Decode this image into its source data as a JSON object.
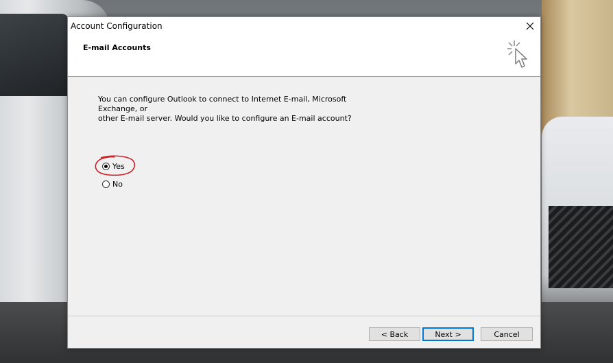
{
  "window": {
    "title": "Account Configuration",
    "close_glyph": "✕"
  },
  "header": {
    "title": "E-mail Accounts",
    "icon": "sparkle-cursor-icon"
  },
  "main": {
    "description_line1": "You can configure Outlook to connect to Internet E-mail, Microsoft Exchange, or",
    "description_line2": "other E-mail server. Would you like to configure an E-mail account?",
    "options": [
      {
        "label": "Yes",
        "selected": true
      },
      {
        "label": "No",
        "selected": false
      }
    ],
    "annotation_color": "#d0202a"
  },
  "footer": {
    "back_label": "< Back",
    "next_label": "Next >",
    "cancel_label": "Cancel"
  }
}
